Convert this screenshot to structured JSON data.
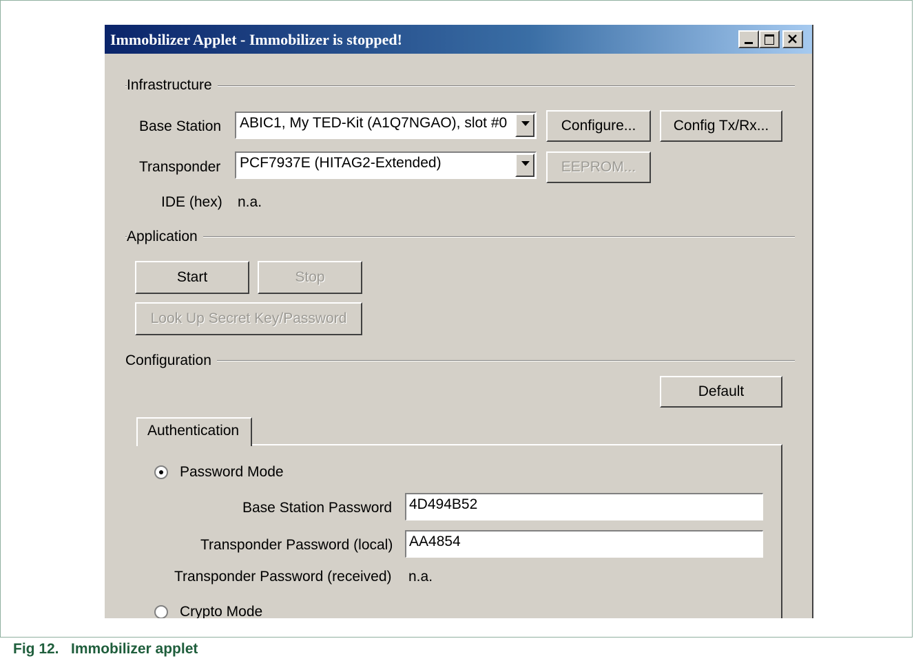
{
  "window": {
    "title": "Immobilizer Applet - Immobilizer is stopped!",
    "controls": [
      "minimize-icon",
      "maximize-icon",
      "close-icon"
    ]
  },
  "infrastructure": {
    "group_label": "Infrastructure",
    "base_station_label": "Base Station",
    "base_station_value": "ABIC1, My TED-Kit (A1Q7NGAO), slot #0",
    "configure_button": "Configure...",
    "config_txrx_button": "Config Tx/Rx...",
    "transponder_label": "Transponder",
    "transponder_value": "PCF7937E (HITAG2-Extended)",
    "eeprom_button": "EEPROM...",
    "ide_label": "IDE (hex)",
    "ide_value": "n.a."
  },
  "application": {
    "group_label": "Application",
    "start_button": "Start",
    "stop_button": "Stop",
    "lookup_button": "Look Up Secret Key/Password"
  },
  "configuration": {
    "group_label": "Configuration",
    "default_button": "Default",
    "tab_label": "Authentication",
    "password_mode_label": "Password Mode",
    "password_mode_selected": true,
    "base_station_password_label": "Base Station Password",
    "base_station_password_value": "4D494B52",
    "transponder_password_local_label": "Transponder Password (local)",
    "transponder_password_local_value": "AA4854",
    "transponder_password_received_label": "Transponder Password (received)",
    "transponder_password_received_value": "n.a.",
    "crypto_mode_label": "Crypto Mode"
  },
  "caption": "Fig 12.   Immobilizer applet"
}
